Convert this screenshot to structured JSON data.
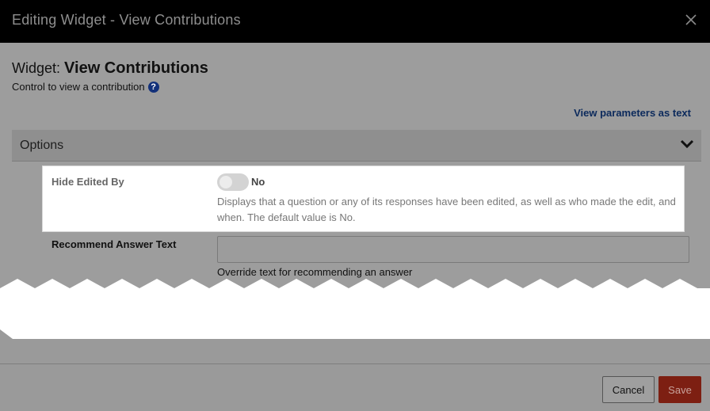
{
  "dialog": {
    "title": "Editing Widget - View Contributions",
    "close_icon": "close-icon"
  },
  "widget": {
    "prefix": "Widget: ",
    "name": "View Contributions",
    "description": "Control to view a contribution",
    "help_icon": "?"
  },
  "links": {
    "view_params": "View parameters as text"
  },
  "options": {
    "section_label": "Options",
    "chevron_icon": "chevron-down-icon"
  },
  "fields": {
    "hide_edited_by": {
      "label": "Hide Edited By",
      "toggle_value": "No",
      "toggle_on": false,
      "description": "Displays that a question or any of its responses have been edited, as well as who made the edit, and when. The default value is No."
    },
    "recommend_answer_text": {
      "label": "Recommend Answer Text",
      "value": "",
      "help": "Override text for recommending an answer"
    }
  },
  "footer": {
    "cancel_label": "Cancel",
    "save_label": "Save"
  },
  "colors": {
    "titlebar": "#000000",
    "overlay": "#9a9a9a",
    "save_button": "#7d1f12",
    "link": "#0c2a5c",
    "help_badge": "#13317a"
  }
}
